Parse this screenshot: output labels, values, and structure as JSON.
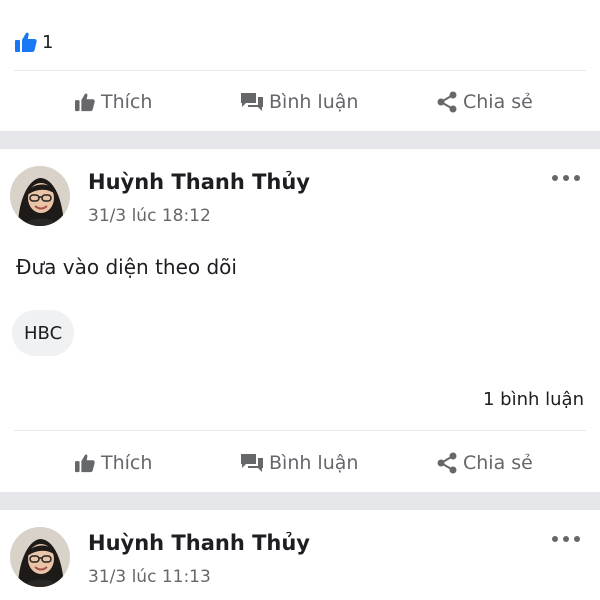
{
  "top": {
    "like_count": "1",
    "actions": {
      "like": "Thích",
      "comment": "Bình luận",
      "share": "Chia sẻ"
    }
  },
  "posts": [
    {
      "author": "Huỳnh Thanh Thủy",
      "time": "31/3 lúc 18:12",
      "text": "Đưa vào diện theo dõi",
      "comment_preview": "HBC",
      "comment_count": "1 bình luận",
      "actions": {
        "like": "Thích",
        "comment": "Bình luận",
        "share": "Chia sẻ"
      }
    },
    {
      "author": "Huỳnh Thanh Thủy",
      "time": "31/3 lúc 11:13"
    }
  ],
  "colors": {
    "like_blue": "#1877f2",
    "icon_gray": "#65676b",
    "separator": "#e4e6e9"
  },
  "icons": [
    "like-badge-icon",
    "thumbs-up-icon",
    "comment-icon",
    "share-icon",
    "more-icon"
  ]
}
